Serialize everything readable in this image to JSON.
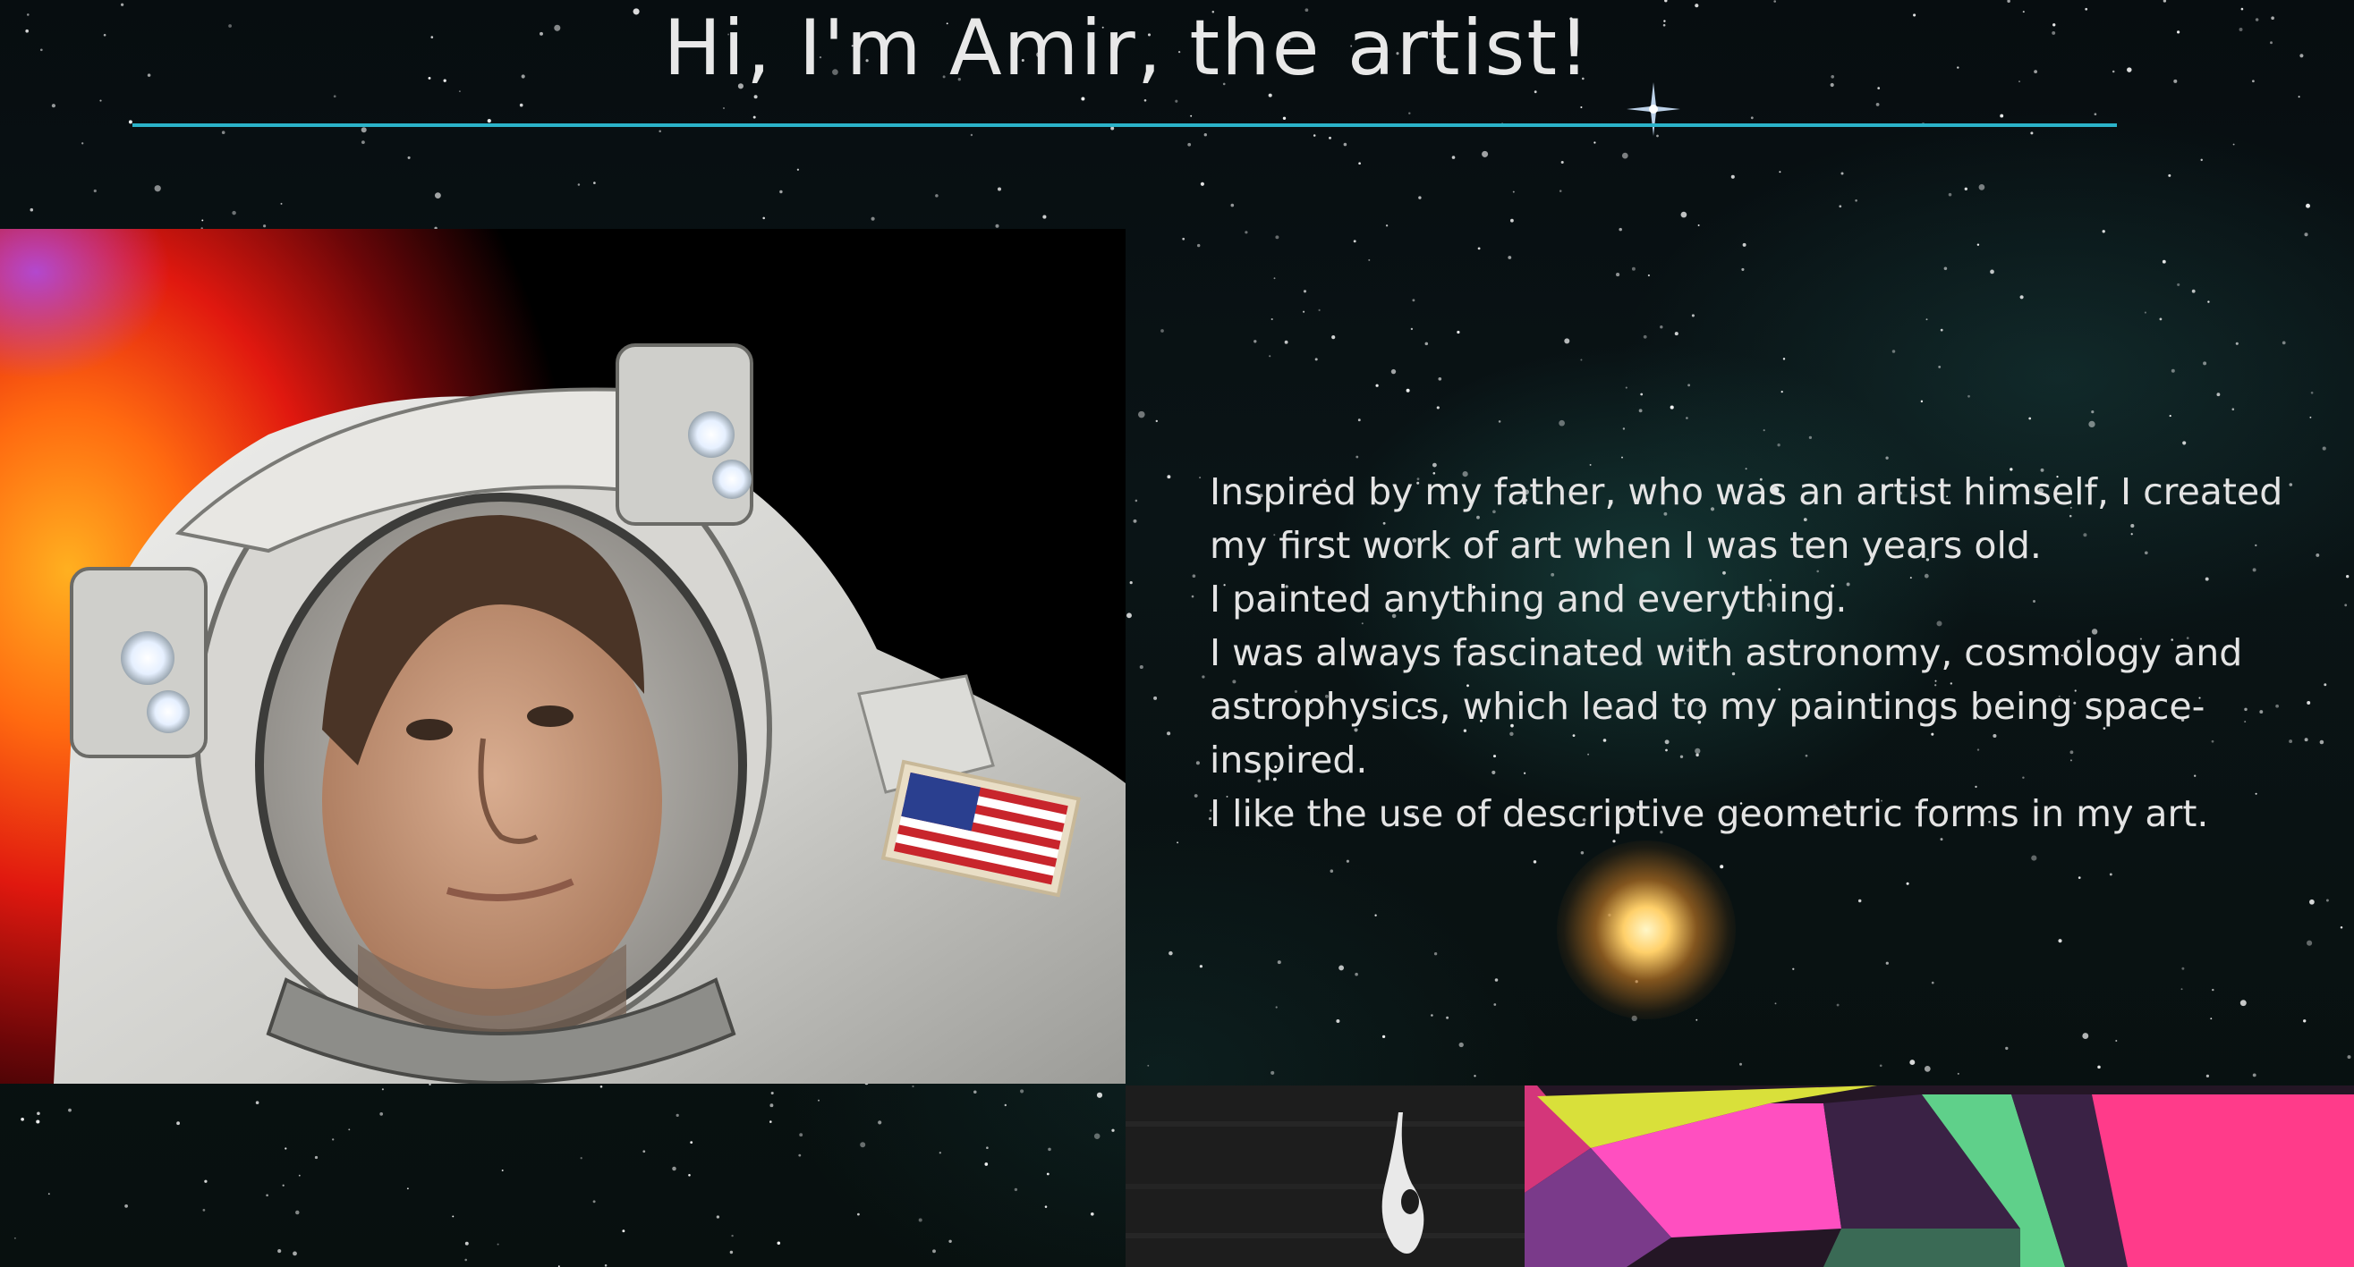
{
  "header": {
    "title": "Hi, I'm Amir, the artist!"
  },
  "hero": {
    "image_name": "astronaut-portrait"
  },
  "bio": {
    "paragraphs": [
      "Inspired by my father, who was an artist himself, I created my first work of art when I was ten years old.",
      "I painted anything and everything.",
      "I was always fascinated with astronomy, cosmology and astrophysics, which lead to my paintings being space-inspired.",
      "I like the use of descriptive geometric forms in my art."
    ]
  },
  "gallery": {
    "items": [
      "dark-wood-painting",
      "geometric-painting"
    ]
  },
  "colors": {
    "accent_rule": "#2bb3c9",
    "background": "#050a0d",
    "text": "#e6e6e6"
  }
}
